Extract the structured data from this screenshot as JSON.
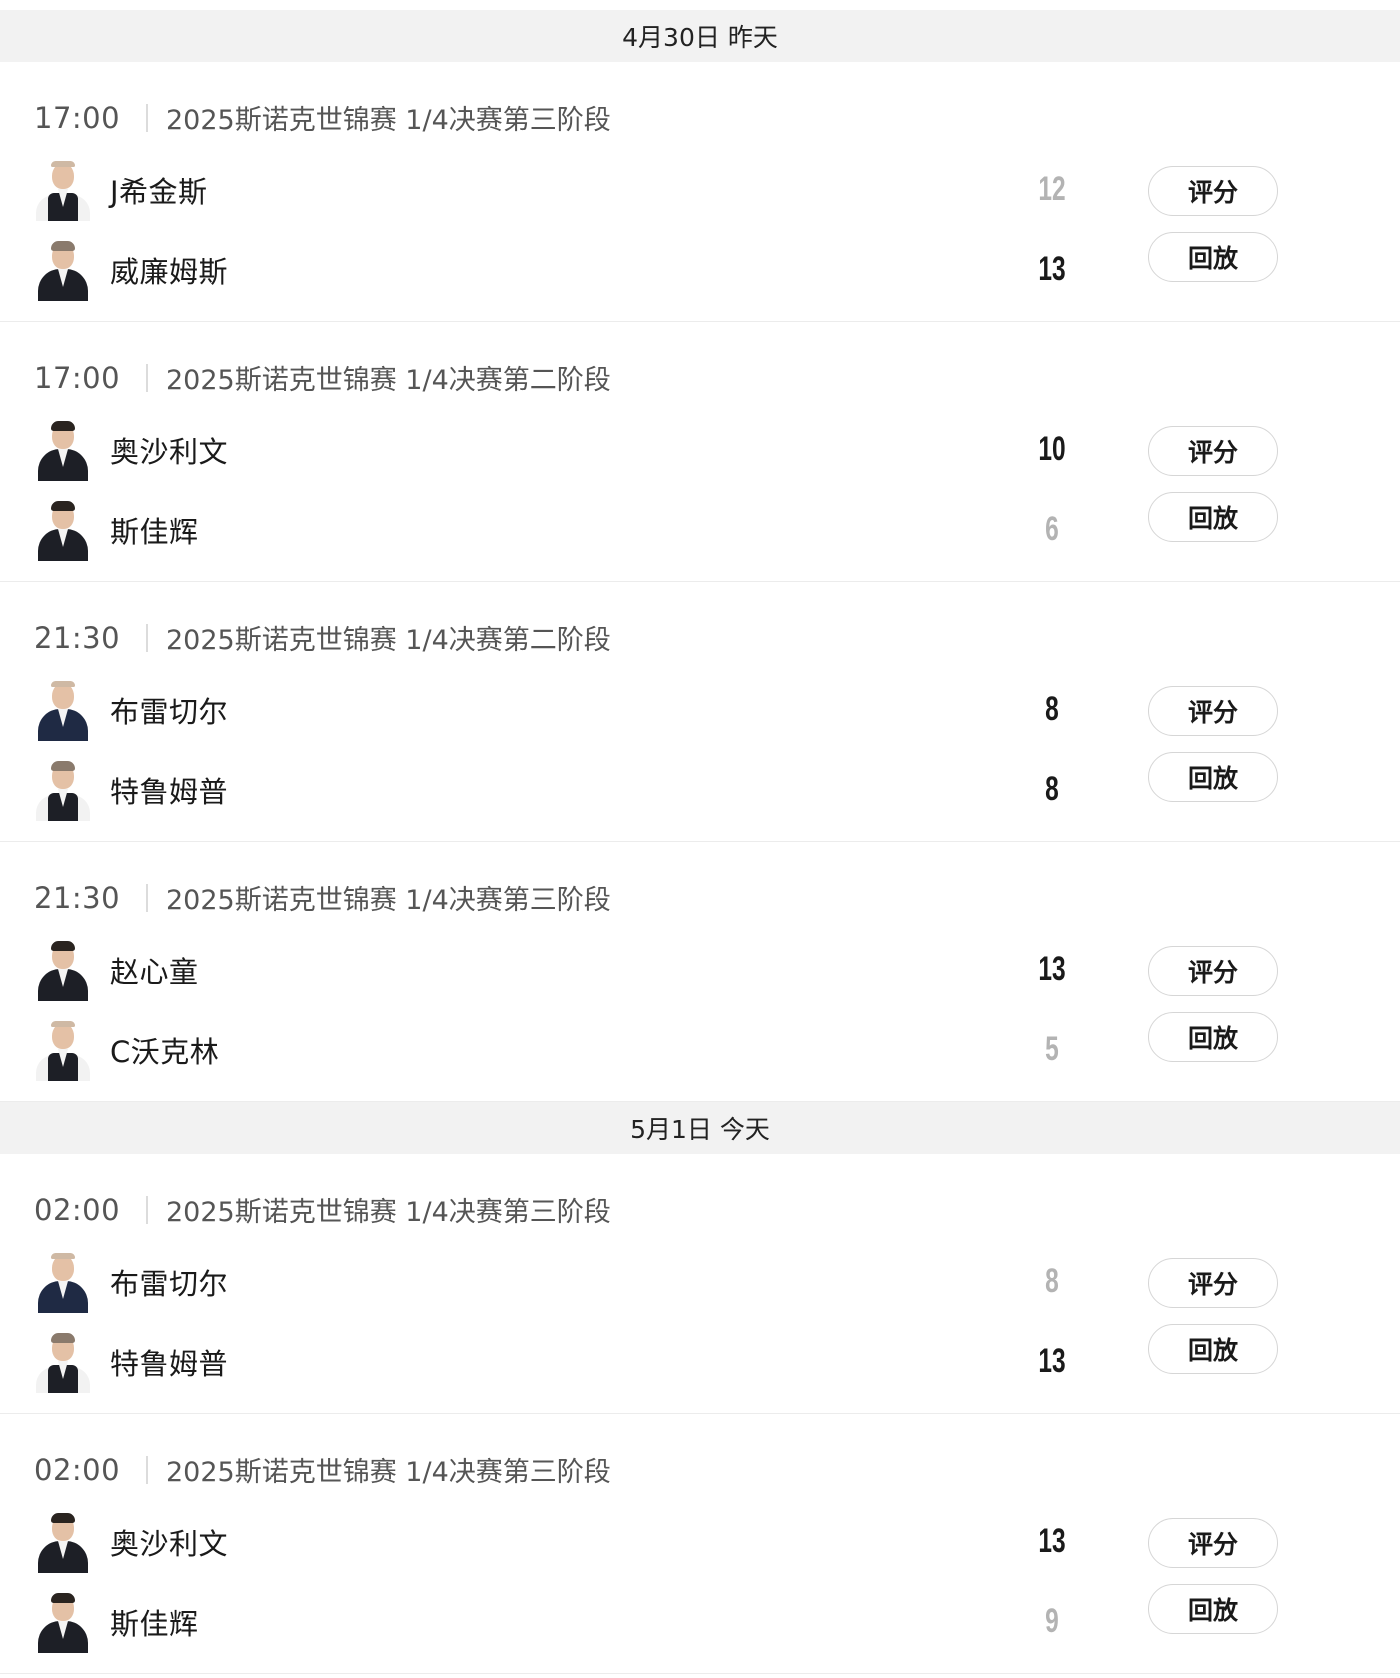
{
  "days": [
    {
      "label": "4月30日 昨天",
      "matches": [
        {
          "time": "17:00",
          "event": "2025斯诺克世锦赛 1/4决赛第三阶段",
          "players": [
            {
              "name": "J希金斯",
              "score": "12",
              "winner": false,
              "avatar": "white-shirt"
            },
            {
              "name": "威廉姆斯",
              "score": "13",
              "winner": true,
              "avatar": "dark"
            }
          ],
          "rate_label": "评分",
          "replay_label": "回放"
        },
        {
          "time": "17:00",
          "event": "2025斯诺克世锦赛 1/4决赛第二阶段",
          "players": [
            {
              "name": "奥沙利文",
              "score": "10",
              "winner": true,
              "avatar": "dark-hair"
            },
            {
              "name": "斯佳辉",
              "score": "6",
              "winner": false,
              "avatar": "dark-hair"
            }
          ],
          "rate_label": "评分",
          "replay_label": "回放"
        },
        {
          "time": "21:30",
          "event": "2025斯诺克世锦赛 1/4决赛第二阶段",
          "players": [
            {
              "name": "布雷切尔",
              "score": "8",
              "winner": true,
              "avatar": "navy"
            },
            {
              "name": "特鲁姆普",
              "score": "8",
              "winner": true,
              "avatar": "white-shirt"
            }
          ],
          "rate_label": "评分",
          "replay_label": "回放"
        },
        {
          "time": "21:30",
          "event": "2025斯诺克世锦赛 1/4决赛第三阶段",
          "players": [
            {
              "name": "赵心童",
              "score": "13",
              "winner": true,
              "avatar": "dark-hair"
            },
            {
              "name": "C沃克林",
              "score": "5",
              "winner": false,
              "avatar": "white-shirt"
            }
          ],
          "rate_label": "评分",
          "replay_label": "回放"
        }
      ]
    },
    {
      "label": "5月1日 今天",
      "matches": [
        {
          "time": "02:00",
          "event": "2025斯诺克世锦赛 1/4决赛第三阶段",
          "players": [
            {
              "name": "布雷切尔",
              "score": "8",
              "winner": false,
              "avatar": "navy"
            },
            {
              "name": "特鲁姆普",
              "score": "13",
              "winner": true,
              "avatar": "white-shirt"
            }
          ],
          "rate_label": "评分",
          "replay_label": "回放"
        },
        {
          "time": "02:00",
          "event": "2025斯诺克世锦赛 1/4决赛第三阶段",
          "players": [
            {
              "name": "奥沙利文",
              "score": "13",
              "winner": true,
              "avatar": "dark-hair"
            },
            {
              "name": "斯佳辉",
              "score": "9",
              "winner": false,
              "avatar": "dark-hair"
            }
          ],
          "rate_label": "评分",
          "replay_label": "回放"
        }
      ]
    }
  ]
}
